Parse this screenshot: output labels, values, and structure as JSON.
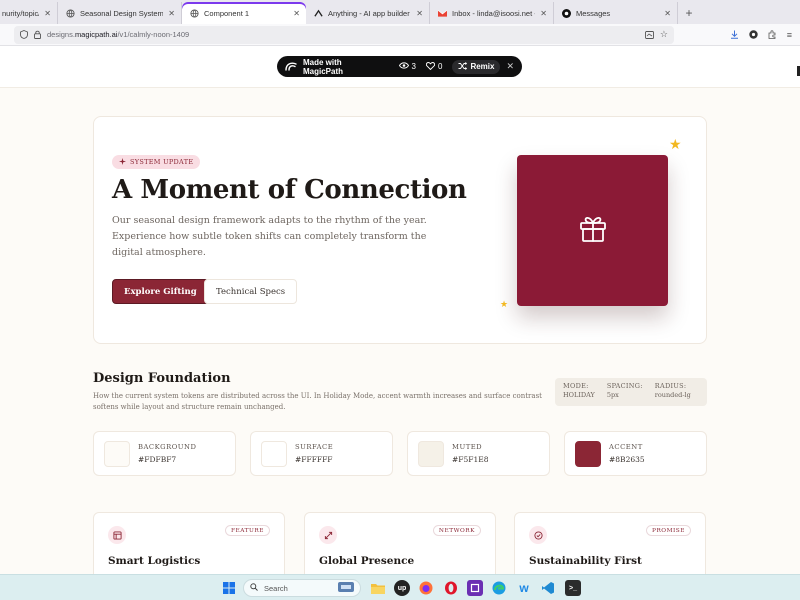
{
  "browser": {
    "tabs": [
      {
        "title": "nurity/topic/h",
        "active": false
      },
      {
        "title": "Seasonal Design System | Magic",
        "active": false
      },
      {
        "title": "Component 1",
        "active": true
      },
      {
        "title": "Anything - AI app builder",
        "active": false
      },
      {
        "title": "Inbox - linda@isoosi.net - ISOO",
        "active": false
      },
      {
        "title": "Messages",
        "active": false
      }
    ],
    "url_prefix": "designs.",
    "url_domain": "magicpath.ai",
    "url_path": "/v1/calmly-noon-1409"
  },
  "magicpath_bar": {
    "title": "Made with MagicPath",
    "views": "3",
    "likes": "0",
    "remix_label": "Remix"
  },
  "hero": {
    "badge": "SYSTEM UPDATE",
    "title": "A Moment of Connection",
    "description": "Our seasonal design framework adapts to the rhythm of the year. Experience how subtle token shifts can completely transform the digital atmosphere.",
    "primary_button": "Explore Gifting",
    "secondary_button": "Technical Specs"
  },
  "foundation": {
    "title": "Design Foundation",
    "description": "How the current system tokens are distributed across the UI. In Holiday Mode, accent warmth increases and surface contrast softens while layout and structure remain unchanged.",
    "meta": [
      {
        "key": "MODE:",
        "value": "HOLIDAY"
      },
      {
        "key": "SPACING:",
        "value": "5px"
      },
      {
        "key": "RADIUS:",
        "value": "rounded-lg"
      }
    ],
    "swatches": [
      {
        "label": "BACKGROUND",
        "hex": "#FDFBF7",
        "color": "#FDFBF7"
      },
      {
        "label": "SURFACE",
        "hex": "#FFFFFF",
        "color": "#FFFFFF"
      },
      {
        "label": "MUTED",
        "hex": "#F5F1E8",
        "color": "#F5F1E8"
      },
      {
        "label": "ACCENT",
        "hex": "#8B2635",
        "color": "#8B2635"
      }
    ]
  },
  "features": [
    {
      "tag": "FEATURE",
      "title": "Smart Logistics",
      "icon": "box-icon"
    },
    {
      "tag": "NETWORK",
      "title": "Global Presence",
      "icon": "expand-arrows-icon"
    },
    {
      "tag": "PROMISE",
      "title": "Sustainability First",
      "icon": "check-circle-icon"
    }
  ],
  "taskbar": {
    "search_placeholder": "Search"
  },
  "colors": {
    "accent": "#8B2635",
    "gift_card": "#8B1A36",
    "star": "#F2B821",
    "page_bg": "#FDFBF7"
  }
}
